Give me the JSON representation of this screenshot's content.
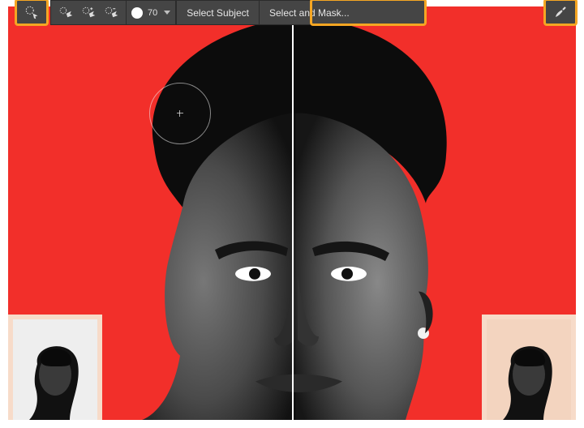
{
  "toolbar": {
    "brush_size": "70",
    "select_subject_label": "Select Subject",
    "select_and_mask_label": "Select and Mask...",
    "icons": {
      "quick_selection": "quick-selection-icon",
      "new_selection": "new-selection-brush-icon",
      "add_to_selection": "add-to-selection-brush-icon",
      "subtract_from_selection": "subtract-from-selection-brush-icon",
      "brush_preview": "brush-preset-icon",
      "refine_edge": "refine-edge-brush-icon"
    }
  },
  "canvas": {
    "background_color": "#f22f2a",
    "thumbnail_bg": "#f7dbc9"
  }
}
